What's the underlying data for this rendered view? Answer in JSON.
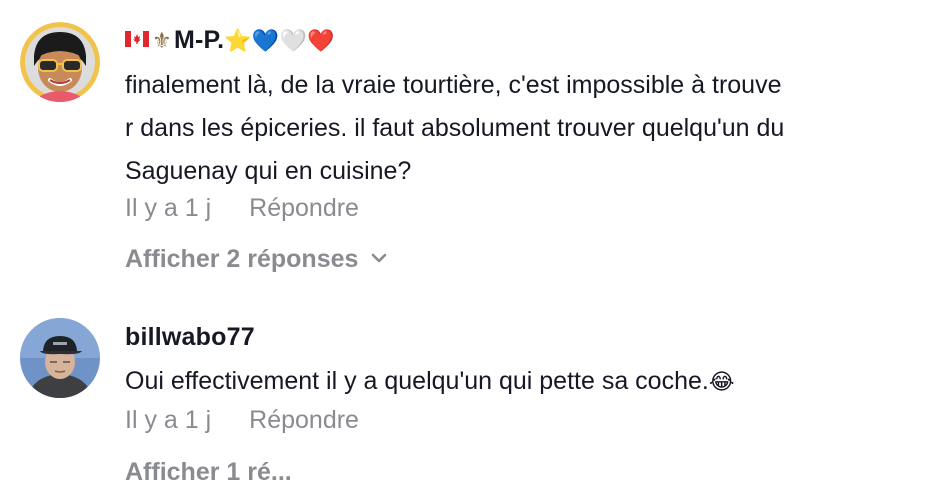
{
  "comments": [
    {
      "username_prefix_icons": [
        "canada-flag-icon",
        "fleur-de-lis-icon"
      ],
      "username": "M-P.",
      "username_suffix_emoji": "⭐💙🤍❤️",
      "text_lines": [
        "finalement là, de la vraie tourtière, c'est impossible à trouve",
        "r dans les épiceries. il faut absolument trouver quelqu'un du",
        "Saguenay qui en cuisine?"
      ],
      "time": "Il y a 1 j",
      "reply_label": "Répondre",
      "view_replies_label": "Afficher 2 réponses"
    },
    {
      "username": "billwabo77",
      "text": "Oui effectivement il y a quelqu'un qui pette sa coche.",
      "text_emoji": "😂",
      "time": "Il y a 1 j",
      "reply_label": "Répondre",
      "view_replies_label": "Afficher 1 ré..."
    }
  ],
  "colors": {
    "text": "#161823",
    "secondary": "#8a8b91",
    "background": "#ffffff"
  }
}
